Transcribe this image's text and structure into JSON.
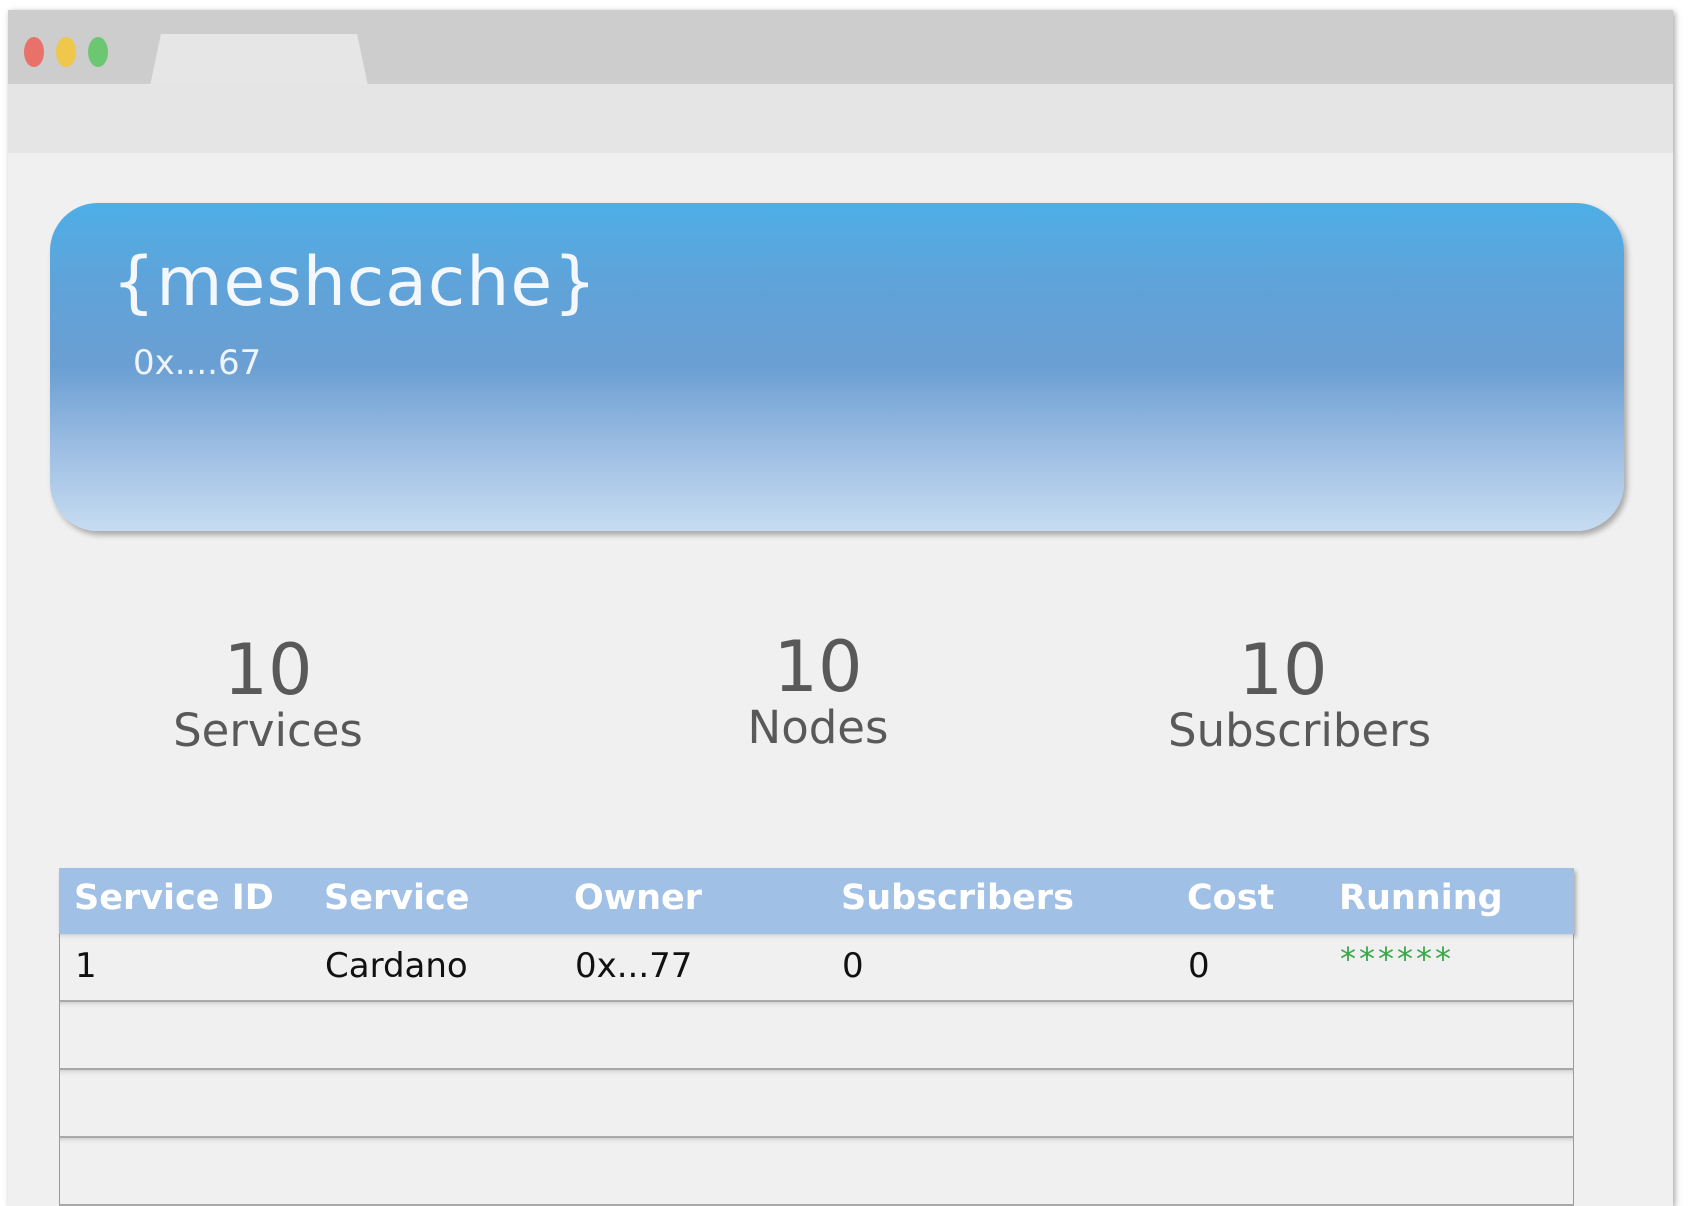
{
  "window": {
    "tab_title": ""
  },
  "banner": {
    "brand": "{meshcache}",
    "address": "0x....67"
  },
  "stats": {
    "services": {
      "value": "10",
      "label": "Services"
    },
    "nodes": {
      "value": "10",
      "label": "Nodes"
    },
    "subscribers": {
      "value": "10",
      "label": "Subscribers"
    }
  },
  "table": {
    "columns": [
      "Service ID",
      "Service",
      "Owner",
      "Subscribers",
      "Cost",
      "Running"
    ],
    "rows": [
      {
        "service_id": "1",
        "service": "Cardano",
        "owner": "0x...77",
        "subscribers": "0",
        "cost": "0",
        "running": "******"
      }
    ]
  },
  "colors": {
    "header_bg": "#a1c0e5",
    "banner_top": "#4eaee6",
    "banner_bottom": "#c6dcf1",
    "running_indicator": "#3aa84a"
  }
}
